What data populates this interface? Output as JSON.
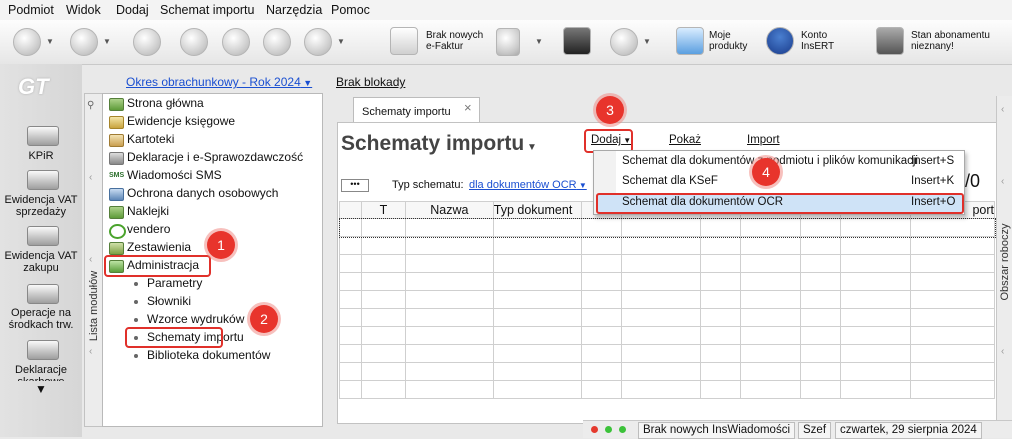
{
  "menu": [
    "Podmiot",
    "Widok",
    "Dodaj",
    "Schemat importu",
    "Narzędzia",
    "Pomoc"
  ],
  "toolbar": {
    "ksef_label_1": "Brak nowych",
    "ksef_label_2": "e-Faktur",
    "products_label_1": "Moje",
    "products_label_2": "produkty",
    "insert_label_1": "Konto",
    "insert_label_2": "InsERT",
    "subscription_label_1": "Stan abonamentu",
    "subscription_label_2": "nieznany!"
  },
  "logo": "GT",
  "period": "Okres obrachunkowy - Rok 2024",
  "blockade": "Brak blokady",
  "left_nav": [
    {
      "label_1": "KPiR",
      "label_2": ""
    },
    {
      "label_1": "Ewidencja VAT",
      "label_2": "sprzedaży"
    },
    {
      "label_1": "Ewidencja VAT",
      "label_2": "zakupu"
    },
    {
      "label_1": "Operacje na",
      "label_2": "środkach trw."
    },
    {
      "label_1": "Deklaracje",
      "label_2": "skarbowe"
    }
  ],
  "modules_vertical_label": "Lista modułów",
  "modules": [
    "Strona główna",
    "Ewidencje księgowe",
    "Kartoteki",
    "Deklaracje i e-Sprawozdawczość",
    "Wiadomości SMS",
    "Ochrona danych osobowych",
    "Naklejki",
    "vendero",
    "Zestawienia",
    "Administracja"
  ],
  "sms_icon_text": "SMS",
  "submodules": [
    "Parametry",
    "Słowniki",
    "Wzorce wydruków",
    "Schematy importu",
    "Biblioteka dokumentów"
  ],
  "tab": {
    "label": "Schematy importu",
    "close": "×"
  },
  "page_title": "Schematy importu",
  "actions": {
    "add": "Dodaj",
    "preview": "Pokaż",
    "import": "Import"
  },
  "filter": {
    "dots": "•••",
    "label": "Typ schematu:",
    "value": "dla dokumentów OCR"
  },
  "counter": "/0",
  "grid_headers": [
    "T",
    "Nazwa",
    "Typ dokument",
    "",
    "",
    "",
    "",
    "",
    "",
    "",
    "port"
  ],
  "dropdown": [
    {
      "label": "Schemat dla dokumentów z podmiotu i plików komunikacji",
      "shortcut": "Insert+S"
    },
    {
      "label": "Schemat dla KSeF",
      "shortcut": "Insert+K"
    },
    {
      "label": "Schemat dla dokumentów OCR",
      "shortcut": "Insert+O"
    }
  ],
  "right_panel_label": "Obszar roboczy",
  "badges": [
    "1",
    "2",
    "3",
    "4"
  ],
  "status": {
    "news": "Brak nowych InsWiadomości",
    "user": "Szef",
    "date": "czwartek, 29 sierpnia 2024"
  },
  "colors": {
    "accent_red": "#e0302a",
    "highlight_blue": "#cfe3f7",
    "link_blue": "#1a4fd1"
  }
}
